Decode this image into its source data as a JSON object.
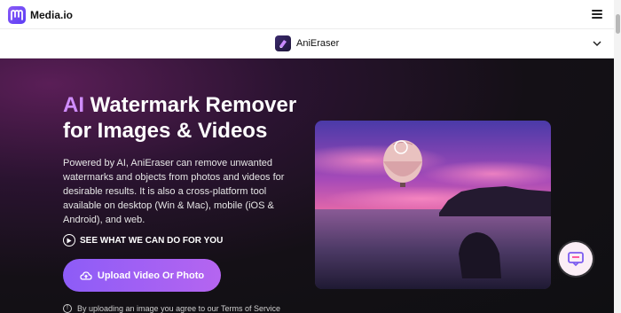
{
  "header": {
    "brand": "Media.io",
    "logo_icon": "media-io-logo-icon",
    "menu_icon": "hamburger-menu-icon"
  },
  "product_bar": {
    "name": "AniEraser",
    "icon": "anieraser-icon",
    "chevron_icon": "chevron-down-icon"
  },
  "hero": {
    "title_accent": "AI",
    "title_line1_rest": " Watermark Remover",
    "title_line2": "for Images & Videos",
    "description": "Powered by AI, AniEraser can remove unwanted watermarks and objects from photos and videos for desirable results. It is also a cross-platform tool available on desktop (Win & Mac), mobile (iOS & Android), and web.",
    "see_link": "SEE WHAT WE CAN DO FOR YOU",
    "upload_button": "Upload Video Or Photo",
    "terms_note": "By uploading an image you agree to our Terms of Service",
    "photo_icon": "hot-air-balloon-sunset-photo"
  },
  "chat": {
    "icon": "chat-support-icon"
  },
  "colors": {
    "accent": "#d08dff",
    "button_start": "#8d5cf7",
    "button_end": "#b565f0",
    "hero_bg": "#141016"
  }
}
